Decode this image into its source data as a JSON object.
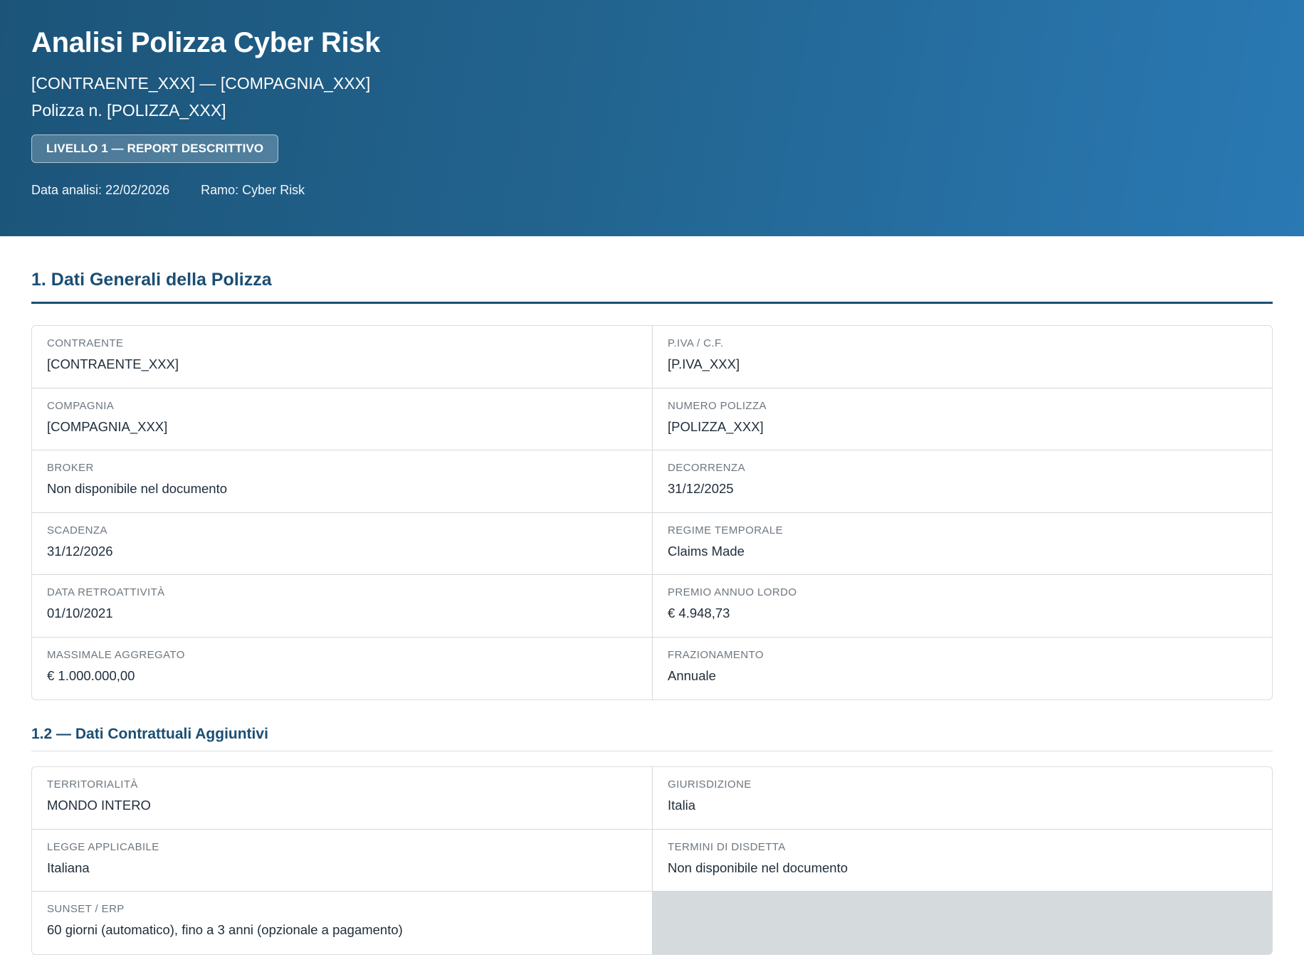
{
  "header": {
    "title": "Analisi Polizza Cyber Risk",
    "subtitle": "[CONTRAENTE_XXX] — [COMPAGNIA_XXX]",
    "policy_line": "Polizza n. [POLIZZA_XXX]",
    "badge": "LIVELLO 1 — REPORT DESCRITTIVO",
    "date_label": "Data analisi: 22/02/2026",
    "branch_label": "Ramo: Cyber Risk"
  },
  "section1": {
    "title": "1. Dati Generali della Polizza",
    "fields": [
      {
        "label": "Contraente",
        "value": "[CONTRAENTE_XXX]"
      },
      {
        "label": "P.IVA / C.F.",
        "value": "[P.IVA_XXX]"
      },
      {
        "label": "Compagnia",
        "value": "[COMPAGNIA_XXX]"
      },
      {
        "label": "Numero Polizza",
        "value": "[POLIZZA_XXX]"
      },
      {
        "label": "Broker",
        "value": "Non disponibile nel documento"
      },
      {
        "label": "Decorrenza",
        "value": "31/12/2025"
      },
      {
        "label": "Scadenza",
        "value": "31/12/2026"
      },
      {
        "label": "Regime Temporale",
        "value": "Claims Made"
      },
      {
        "label": "Data Retroattività",
        "value": "01/10/2021"
      },
      {
        "label": "Premio Annuo Lordo",
        "value": "€ 4.948,73"
      },
      {
        "label": "Massimale Aggregato",
        "value": "€ 1.000.000,00"
      },
      {
        "label": "Frazionamento",
        "value": "Annuale"
      }
    ]
  },
  "section12": {
    "title": "1.2 — Dati Contrattuali Aggiuntivi",
    "fields": [
      {
        "label": "Territorialità",
        "value": "MONDO INTERO"
      },
      {
        "label": "Giurisdizione",
        "value": "Italia"
      },
      {
        "label": "Legge Applicabile",
        "value": "Italiana"
      },
      {
        "label": "Termini di Disdetta",
        "value": "Non disponibile nel documento"
      },
      {
        "label": "Sunset / ERP",
        "value": "60 giorni (automatico), fino a 3 anni (opzionale a pagamento)"
      }
    ]
  }
}
